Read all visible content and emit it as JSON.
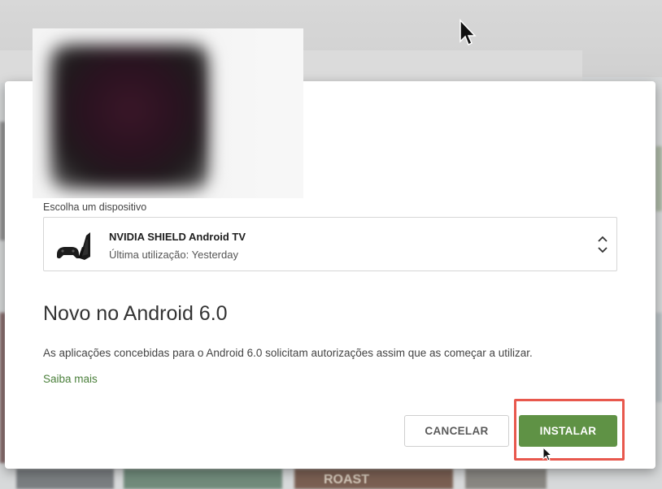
{
  "colors": {
    "accent_green": "#5f9245",
    "link_green": "#4a7f3a",
    "highlight_red": "#e8584d"
  },
  "dialog": {
    "app_art_icon": "blurred-app-icon",
    "device_picker": {
      "label": "Escolha um dispositivo",
      "device_name": "NVIDIA SHIELD Android TV",
      "last_used": "Última utilização: Yesterday",
      "device_icon": "shield-tv-icon",
      "chevron_icon": "up-down-chevron-icon"
    },
    "permissions": {
      "title": "Novo no Android 6.0",
      "description": "As aplicações concebidas para o Android 6.0 solicitam autorizações assim que as começar a utilizar.",
      "learn_more": "Saiba mais"
    },
    "buttons": {
      "cancel": "CANCELAR",
      "install": "INSTALAR"
    }
  },
  "background_text": {
    "roast": "ROAST"
  }
}
